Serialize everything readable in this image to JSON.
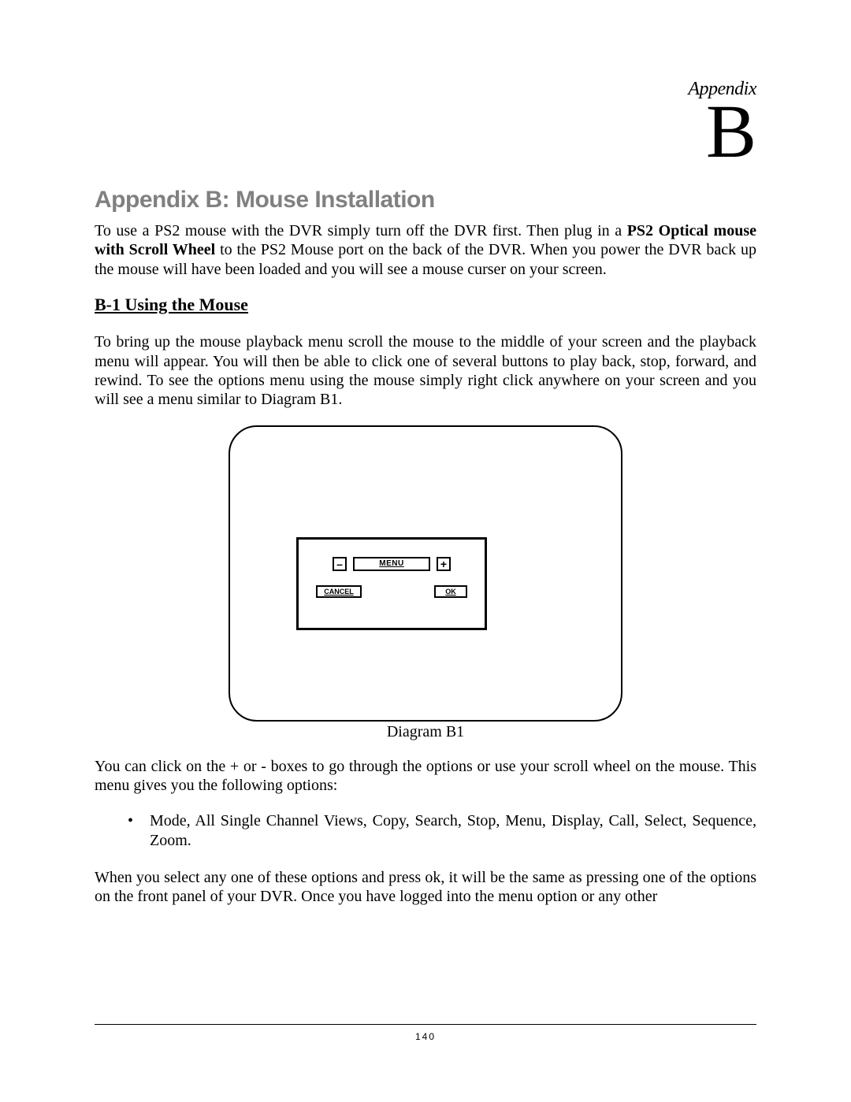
{
  "appendix": {
    "label": "Appendix",
    "letter": "B"
  },
  "title": "Appendix B: Mouse Installation",
  "intro": {
    "part1": "To use a PS2 mouse with the DVR simply turn off the DVR first. Then plug in a ",
    "bold1": "PS2 Optical mouse with Scroll Wheel",
    "part2": " to the PS2 Mouse port on the back of the DVR. When you power the DVR back up the mouse will have been loaded and you will see a mouse curser on your screen."
  },
  "section": {
    "heading": "B-1 Using the Mouse",
    "para1": "To bring up the mouse playback menu scroll the mouse to the middle of your screen and the playback menu will appear. You will then be able to click one of several buttons to play back, stop, forward, and rewind. To see the options menu using the mouse simply right click anywhere on your screen and you will see a menu similar to Diagram B1."
  },
  "diagram": {
    "menu_label": "MENU",
    "minus": "–",
    "plus": "+",
    "cancel": "CANCEL",
    "ok": "OK",
    "caption": "Diagram B1"
  },
  "after": {
    "para2": "You can click on the + or - boxes to go through the options or use your scroll wheel on the mouse. This menu gives you the following options:",
    "bullet": "Mode, All Single Channel Views, Copy, Search, Stop, Menu, Display, Call, Select, Sequence, Zoom.",
    "para3": "When you select any one of these options and press ok, it will be the same as pressing one of the options on the front panel of your DVR. Once you have logged into the menu option or any other"
  },
  "footer": {
    "page": "140"
  }
}
